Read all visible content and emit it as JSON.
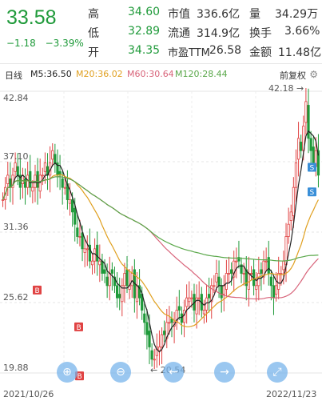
{
  "quote": {
    "price": "33.58",
    "change": "−1.18",
    "change_pct": "−3.39%",
    "stats": [
      {
        "label": "高",
        "value": "34.60"
      },
      {
        "label": "低",
        "value": "32.89"
      },
      {
        "label": "开",
        "value": "34.35"
      },
      {
        "label": "市值",
        "value": "336.6亿"
      },
      {
        "label": "流通",
        "value": "314.9亿"
      },
      {
        "label": "市盈TTM",
        "value": "26.58"
      },
      {
        "label": "量",
        "value": "34.29万"
      },
      {
        "label": "换手",
        "value": "3.66%"
      },
      {
        "label": "金额",
        "value": "11.48亿"
      }
    ]
  },
  "ma_bar": {
    "period": "日线",
    "m5": "M5:36.50",
    "m20": "M20:36.02",
    "m60": "M60:30.64",
    "m120": "M120:28.44",
    "adjust": "前复权"
  },
  "colors": {
    "up": "#e04343",
    "down": "#1f9a3a",
    "m5": "#222222",
    "m20": "#e0a020",
    "m60": "#d8647a",
    "m120": "#5aa84a"
  },
  "chart_data": {
    "type": "candlestick",
    "y_ticks": [
      "42.84",
      "37.10",
      "31.36",
      "25.62",
      "19.88"
    ],
    "y_tick_values": [
      42.84,
      37.1,
      31.36,
      25.62,
      19.88
    ],
    "x_labels": [
      "2021/10/26",
      "2022/11/23"
    ],
    "annotations": {
      "high": "42.18",
      "low": "20.54"
    },
    "markers": [
      "B",
      "B",
      "B",
      "S",
      "S"
    ],
    "closes": [
      34,
      35,
      36,
      35,
      36,
      37,
      36,
      35,
      36,
      35,
      36,
      35,
      35,
      36,
      35,
      36,
      36,
      37,
      36,
      37,
      38,
      37,
      36,
      36,
      35,
      35,
      34,
      34,
      33,
      32,
      31,
      31,
      30,
      30,
      30,
      29,
      29,
      30,
      29,
      29,
      28,
      28,
      27,
      28,
      28,
      27,
      26,
      26,
      27,
      28,
      27,
      27,
      28,
      26,
      27,
      26,
      25,
      24,
      23,
      22,
      21,
      21,
      22,
      22,
      23,
      23,
      24,
      24,
      24,
      24,
      25,
      25,
      24,
      25,
      26,
      26,
      26,
      25,
      26,
      26,
      25,
      25,
      26,
      26,
      27,
      27,
      28,
      27,
      26,
      27,
      28,
      28,
      28,
      29,
      29,
      29,
      28,
      28,
      27,
      28,
      28,
      27,
      27,
      28,
      28,
      29,
      29,
      28,
      27,
      26,
      27,
      28,
      28,
      29,
      31,
      32,
      33,
      35,
      37,
      39,
      38,
      40,
      42,
      39,
      38,
      37,
      38,
      36
    ]
  }
}
